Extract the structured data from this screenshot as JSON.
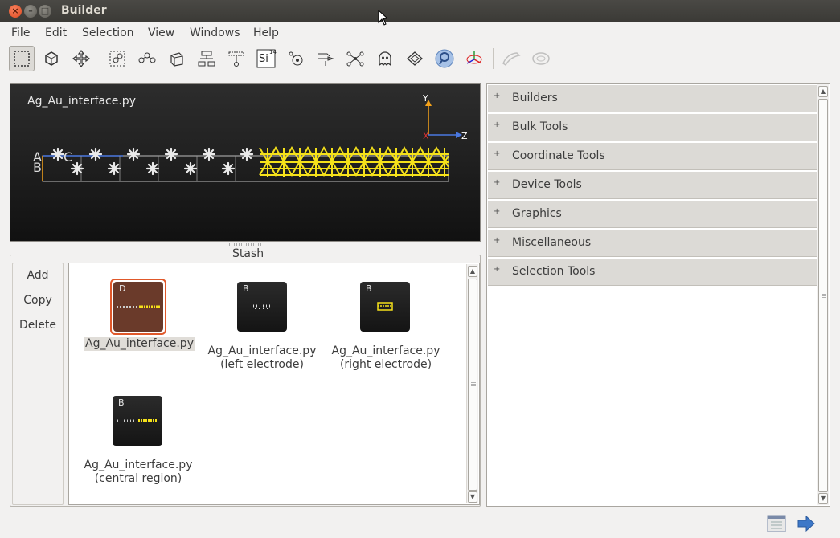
{
  "window": {
    "title": "Builder"
  },
  "menu": [
    "File",
    "Edit",
    "Selection",
    "View",
    "Windows",
    "Help"
  ],
  "toolbar": {
    "tools": [
      "select-rectangle",
      "select-hexagon",
      "move",
      "select-pattern",
      "chain",
      "cube",
      "tree",
      "dangling",
      "element-si",
      "atom-nucleus",
      "arrows-merge",
      "star-network",
      "ghost",
      "eraser",
      "magnify",
      "axes",
      "bond-disabled",
      "bond2-disabled"
    ],
    "element_label": "Si",
    "element_number": "14"
  },
  "viewer": {
    "title": "Ag_Au_interface.py",
    "axes": {
      "y": "Y",
      "z": "Z",
      "x": "X"
    },
    "labels": {
      "a": "A",
      "b": "B",
      "c": "C"
    }
  },
  "stash": {
    "title": "Stash",
    "buttons": [
      "Add",
      "Copy",
      "Delete"
    ],
    "items": [
      {
        "badge": "D",
        "line1": "Ag_Au_interface.py",
        "line2": "",
        "selected": true
      },
      {
        "badge": "B",
        "line1": "Ag_Au_interface.py",
        "line2": "(left electrode)",
        "selected": false
      },
      {
        "badge": "B",
        "line1": "Ag_Au_interface.py",
        "line2": "(right electrode)",
        "selected": false
      },
      {
        "badge": "B",
        "line1": "Ag_Au_interface.py",
        "line2": "(central region)",
        "selected": false
      }
    ]
  },
  "tools_panel": {
    "sections": [
      "Builders",
      "Bulk Tools",
      "Coordinate Tools",
      "Device Tools",
      "Graphics",
      "Miscellaneous",
      "Selection Tools"
    ]
  },
  "colors": {
    "accent": "#e0582a",
    "gold": "#f5e11a",
    "silver": "#e8e8e8"
  }
}
